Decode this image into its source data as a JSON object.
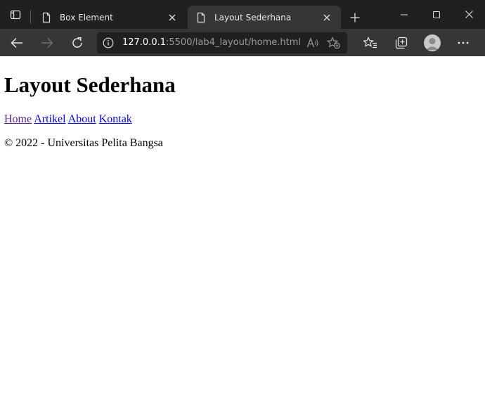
{
  "browser": {
    "tabs": [
      {
        "title": "Box Element",
        "active": false
      },
      {
        "title": "Layout Sederhana",
        "active": true
      }
    ],
    "address": {
      "host": "127.0.0.1",
      "path": ":5500/lab4_layout/home.html"
    },
    "icons": {
      "tab_actions": "tab-actions-icon",
      "page": "page-icon",
      "close": "close-icon",
      "new_tab": "plus-icon",
      "minimize": "minimize-icon",
      "maximize": "maximize-icon",
      "window_close": "window-close-icon",
      "back": "back-arrow-icon",
      "forward": "forward-arrow-icon",
      "refresh": "refresh-icon",
      "site_info": "info-icon",
      "read_aloud": "read-aloud-icon",
      "add_favorite": "add-favorite-icon",
      "favorites": "favorites-icon",
      "collections": "collections-icon",
      "profile": "profile-avatar",
      "more": "more-icon"
    },
    "colors": {
      "tabstrip_bg": "#202020",
      "toolbar_bg": "#363636",
      "address_bg": "#202020",
      "link": "#0000ee",
      "link_visited": "#551a8b"
    }
  },
  "page": {
    "heading": "Layout Sederhana",
    "nav": [
      "Home",
      "Artikel",
      "About",
      "Kontak"
    ],
    "footer": "© 2022 - Universitas Pelita Bangsa"
  }
}
